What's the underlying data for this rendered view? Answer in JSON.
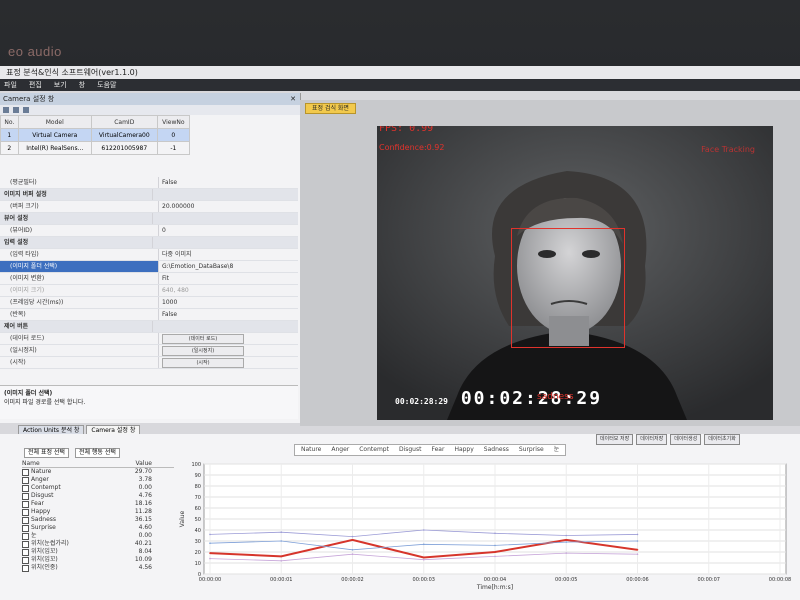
{
  "bezel": {
    "logo": "eo audio"
  },
  "window": {
    "title": "표정 분석&인식 소프트웨어(ver1.1.0)"
  },
  "menu": [
    "파일",
    "편집",
    "보기",
    "창",
    "도움말"
  ],
  "camera_panel": {
    "title": "Camera 설정 창",
    "columns": [
      "No.",
      "Model",
      "CamID",
      "ViewNo"
    ],
    "rows": [
      {
        "no": "1",
        "model": "Virtual Camera",
        "camid": "VirtualCamera00",
        "viewno": "0"
      },
      {
        "no": "2",
        "model": "Intel(R) RealSens...",
        "camid": "612201005987",
        "viewno": "-1"
      }
    ]
  },
  "properties": [
    {
      "key": "(평균필터)",
      "value": "False",
      "type": "item"
    },
    {
      "key": "이미지 버퍼 설정",
      "value": "",
      "type": "cat"
    },
    {
      "key": "(버퍼 크기)",
      "value": "20.000000",
      "type": "item"
    },
    {
      "key": "뷰어 설정",
      "value": "",
      "type": "cat"
    },
    {
      "key": "(뷰어ID)",
      "value": "0",
      "type": "item"
    },
    {
      "key": "입력 설정",
      "value": "",
      "type": "cat"
    },
    {
      "key": "(입력 타입)",
      "value": "다중 이미지",
      "type": "item"
    },
    {
      "key": "(이미지 폴더 선택)",
      "value": "G:\\Emotion_DataBase\\8",
      "type": "hl"
    },
    {
      "key": "(이미지 변환)",
      "value": "Fit",
      "type": "item"
    },
    {
      "key": "(이미지 크기)",
      "value": "640, 480",
      "type": "dim"
    },
    {
      "key": "(프레임당 시간(ms))",
      "value": "1000",
      "type": "item"
    },
    {
      "key": "(반복)",
      "value": "False",
      "type": "item"
    },
    {
      "key": "제어 버튼",
      "value": "",
      "type": "cat"
    },
    {
      "key": "(데이터 로드)",
      "value": "(데이터 로드)",
      "type": "btn"
    },
    {
      "key": "(일시정지)",
      "value": "(일시정지)",
      "type": "btn"
    },
    {
      "key": "(시작)",
      "value": "(시작)",
      "type": "btn"
    }
  ],
  "description": {
    "title": "(이미지 폴더 선택)",
    "text": "이미지 파일 경로를 선택 합니다."
  },
  "left_tabs": [
    "Action Units 분석 창",
    "Camera 설정 창"
  ],
  "video": {
    "tab": "표정 검식 화면",
    "fps": "FPS: 0.99",
    "confidence": "Confidence:0.92",
    "status": "Face Tracking",
    "emotion": "sadness",
    "timecode_small": "00:02:28:29",
    "timecode": "00:02:28:29"
  },
  "emotion_panel": {
    "filters": [
      "전체 표정 선택",
      "전체 행동 선택"
    ],
    "columns": [
      "Name",
      "Value"
    ],
    "rows": [
      {
        "name": "Nature",
        "value": "29.70"
      },
      {
        "name": "Anger",
        "value": "3.78"
      },
      {
        "name": "Contempt",
        "value": "0.00"
      },
      {
        "name": "Disgust",
        "value": "4.76"
      },
      {
        "name": "Fear",
        "value": "18.16"
      },
      {
        "name": "Happy",
        "value": "11.28"
      },
      {
        "name": "Sadness",
        "value": "36.15"
      },
      {
        "name": "Surprise",
        "value": "4.60"
      },
      {
        "name": "눈",
        "value": "0.00"
      },
      {
        "name": "위치(눈썹가리)",
        "value": "40.21"
      },
      {
        "name": "위치(입꼬)",
        "value": "8.04"
      },
      {
        "name": "위치(입꼬)",
        "value": "10.09"
      },
      {
        "name": "위치(인중)",
        "value": "4.56"
      }
    ]
  },
  "chart_buttons": [
    "데이터모 저장",
    "데이터저장",
    "데이터생성",
    "데이터초기화"
  ],
  "chart_data": {
    "type": "line",
    "legend": [
      "Nature",
      "Anger",
      "Contempt",
      "Disgust",
      "Fear",
      "Happy",
      "Sadness",
      "Surprise",
      "눈"
    ],
    "ylabel": "Value",
    "xlabel": "Time[h:m:s]",
    "ylim": [
      0,
      100
    ],
    "yticks": [
      0,
      10,
      20,
      30,
      40,
      50,
      60,
      70,
      80,
      90,
      100
    ],
    "xticks": [
      "00:00:00",
      "00:00:01",
      "00:00:02",
      "00:00:03",
      "00:00:04",
      "00:00:05",
      "00:00:06",
      "00:00:07",
      "00:00:08"
    ],
    "series": [
      {
        "name": "Anger",
        "color": "#d6352b",
        "values": [
          19,
          16,
          31,
          15,
          20,
          31,
          22
        ]
      },
      {
        "name": "Nature",
        "color": "#7fa0d8",
        "values": [
          28,
          30,
          22,
          27,
          26,
          29,
          30
        ]
      },
      {
        "name": "Sadness",
        "color": "#9b9bd6",
        "values": [
          36,
          38,
          34,
          40,
          37,
          35,
          36
        ]
      },
      {
        "name": "Fear",
        "color": "#c7a6d9",
        "values": [
          14,
          12,
          18,
          13,
          16,
          19,
          18
        ]
      }
    ],
    "x_index": [
      0,
      1,
      2,
      3,
      4,
      5,
      6
    ]
  }
}
